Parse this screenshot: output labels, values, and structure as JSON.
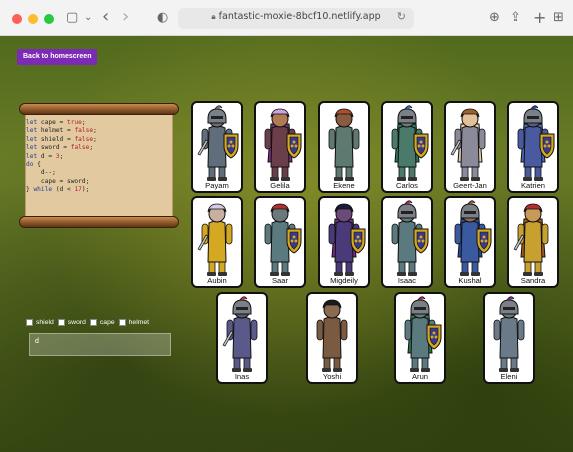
{
  "browser": {
    "url": "fantastic-moxie-8bcf10.netlify.app",
    "icons": {
      "sidebar": "sidebar-icon",
      "back": "chevron-left-icon",
      "forward": "chevron-right-icon",
      "shield": "privacy-shield-icon",
      "lock": "lock-icon",
      "reload": "reload-icon",
      "download": "download-icon",
      "share": "share-icon",
      "new_tab": "plus-icon",
      "tabs": "tab-overview-icon"
    },
    "glyphs": {
      "sidebar": "▢",
      "chevron_down": "⌄",
      "back": "‹",
      "forward": "›",
      "shield": "◐",
      "lock": "🔒",
      "reload": "↻",
      "download": "⊕",
      "share": "⇪",
      "new_tab": "+",
      "tabs": "⊞"
    }
  },
  "page": {
    "back_button_label": "Back to homescreen"
  },
  "code": {
    "lines": [
      {
        "text": "let cape = true;"
      },
      {
        "text": "let helmet = false;"
      },
      {
        "text": "let shield = false;"
      },
      {
        "text": "let sword = false;"
      },
      {
        "text": "let d = 3;"
      },
      {
        "text": "do {"
      },
      {
        "text": "    d--;"
      },
      {
        "text": "    cape = sword;"
      },
      {
        "text": "} while (d < 17);"
      }
    ]
  },
  "cards": [
    {
      "name": "Payam",
      "skin": "#6e6e74",
      "suit": "#5f6e7a",
      "hair": "#7a7a80",
      "cape": "",
      "helmet": true,
      "shield": true,
      "sword": true
    },
    {
      "name": "Gelila",
      "skin": "#b07a52",
      "suit": "#6b3f4a",
      "hair": "#c8a5e0",
      "cape": "#7a2a8a",
      "helmet": false,
      "shield": true,
      "sword": false
    },
    {
      "name": "Ekene",
      "skin": "#8a5a40",
      "suit": "#5e7a70",
      "hair": "#a85030",
      "cape": "",
      "helmet": false,
      "shield": false,
      "sword": false
    },
    {
      "name": "Carlos",
      "skin": "#6a7a7a",
      "suit": "#4a7a6a",
      "hair": "#3a6ac8",
      "cape": "#2a7a5a",
      "helmet": true,
      "shield": true,
      "sword": false
    },
    {
      "name": "Geert-Jan",
      "skin": "#e2c09a",
      "suit": "#8a8a9a",
      "hair": "#a06030",
      "cape": "#e8d0a8",
      "helmet": false,
      "shield": false,
      "sword": true
    },
    {
      "name": "Katrien",
      "skin": "#5a5a8a",
      "suit": "#4a5aa0",
      "hair": "#2a4ab8",
      "cape": "#4a6ab8",
      "helmet": true,
      "shield": true,
      "sword": false
    },
    {
      "name": "Aubin",
      "skin": "#c8b0a0",
      "suit": "#d4a820",
      "hair": "#d8c8e8",
      "cape": "",
      "helmet": false,
      "shield": false,
      "sword": true
    },
    {
      "name": "Saar",
      "skin": "#6a7a7a",
      "suit": "#5a7a80",
      "hair": "#b03030",
      "cape": "",
      "helmet": false,
      "shield": true,
      "sword": false
    },
    {
      "name": "Migdeily",
      "skin": "#6a4a7a",
      "suit": "#4a3a7a",
      "hair": "#1a1a3a",
      "cape": "#7a2a8a",
      "helmet": false,
      "shield": true,
      "sword": false
    },
    {
      "name": "Isaac",
      "skin": "#6a7a7a",
      "suit": "#5a7a80",
      "hair": "#b03060",
      "cape": "",
      "helmet": true,
      "shield": true,
      "sword": false
    },
    {
      "name": "Kushal",
      "skin": "#8a6a5a",
      "suit": "#3a5aa0",
      "hair": "#a05a30",
      "cape": "#2a4aa0",
      "helmet": true,
      "shield": true,
      "sword": false
    },
    {
      "name": "Sandra",
      "skin": "#c89a5a",
      "suit": "#c8a030",
      "hair": "#b03030",
      "cape": "#a05a20",
      "helmet": false,
      "shield": false,
      "sword": true
    },
    {
      "name": "Inas",
      "skin": "#5a5a6a",
      "suit": "#5a5a8a",
      "hair": "#c83060",
      "cape": "",
      "helmet": true,
      "shield": false,
      "sword": true
    },
    {
      "name": "Yoshi",
      "skin": "#8a6a50",
      "suit": "#7a5a40",
      "hair": "#1a1a1a",
      "cape": "",
      "helmet": false,
      "shield": false,
      "sword": false
    },
    {
      "name": "Arun",
      "skin": "#6a7a7a",
      "suit": "#5a7a80",
      "hair": "#b03060",
      "cape": "#2a7a4a",
      "helmet": true,
      "shield": true,
      "sword": false
    },
    {
      "name": "Eleni",
      "skin": "#6a7a80",
      "suit": "#6a7a88",
      "hair": "#8a2aa0",
      "cape": "",
      "helmet": true,
      "shield": false,
      "sword": false
    }
  ],
  "controls": {
    "checkboxes": [
      {
        "label": "shield",
        "checked": false
      },
      {
        "label": "sword",
        "checked": false
      },
      {
        "label": "cape",
        "checked": false
      },
      {
        "label": "helmet",
        "checked": false
      }
    ],
    "variable_input_value": "d"
  }
}
